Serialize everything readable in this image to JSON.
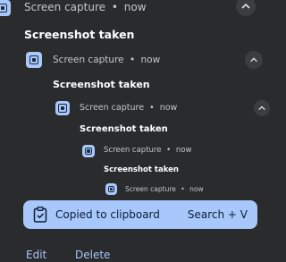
{
  "notifications": [
    {
      "app": "Screen capture",
      "sep": "•",
      "time": "now",
      "title": "Screenshot taken"
    },
    {
      "app": "Screen capture",
      "sep": "•",
      "time": "now",
      "title": "Screenshot taken"
    },
    {
      "app": "Screen capture",
      "sep": "•",
      "time": "now",
      "title": "Screenshot taken"
    },
    {
      "app": "Screen capture",
      "sep": "•",
      "time": "now",
      "title": "Screenshot taken"
    },
    {
      "app": "Screen capture",
      "sep": "•",
      "time": "now"
    }
  ],
  "toast": {
    "message": "Copied to clipboard",
    "shortcut": "Search + V"
  },
  "actions": {
    "edit": "Edit",
    "delete": "Delete"
  },
  "colors": {
    "background": "#2a2b2d",
    "accent": "#a8c7fa",
    "chevron_button": "#3c3d40"
  },
  "icons": {
    "app_icon": "screen-capture-icon",
    "expand": "chevron-up-icon",
    "toast_icon": "clipboard-check-icon"
  }
}
